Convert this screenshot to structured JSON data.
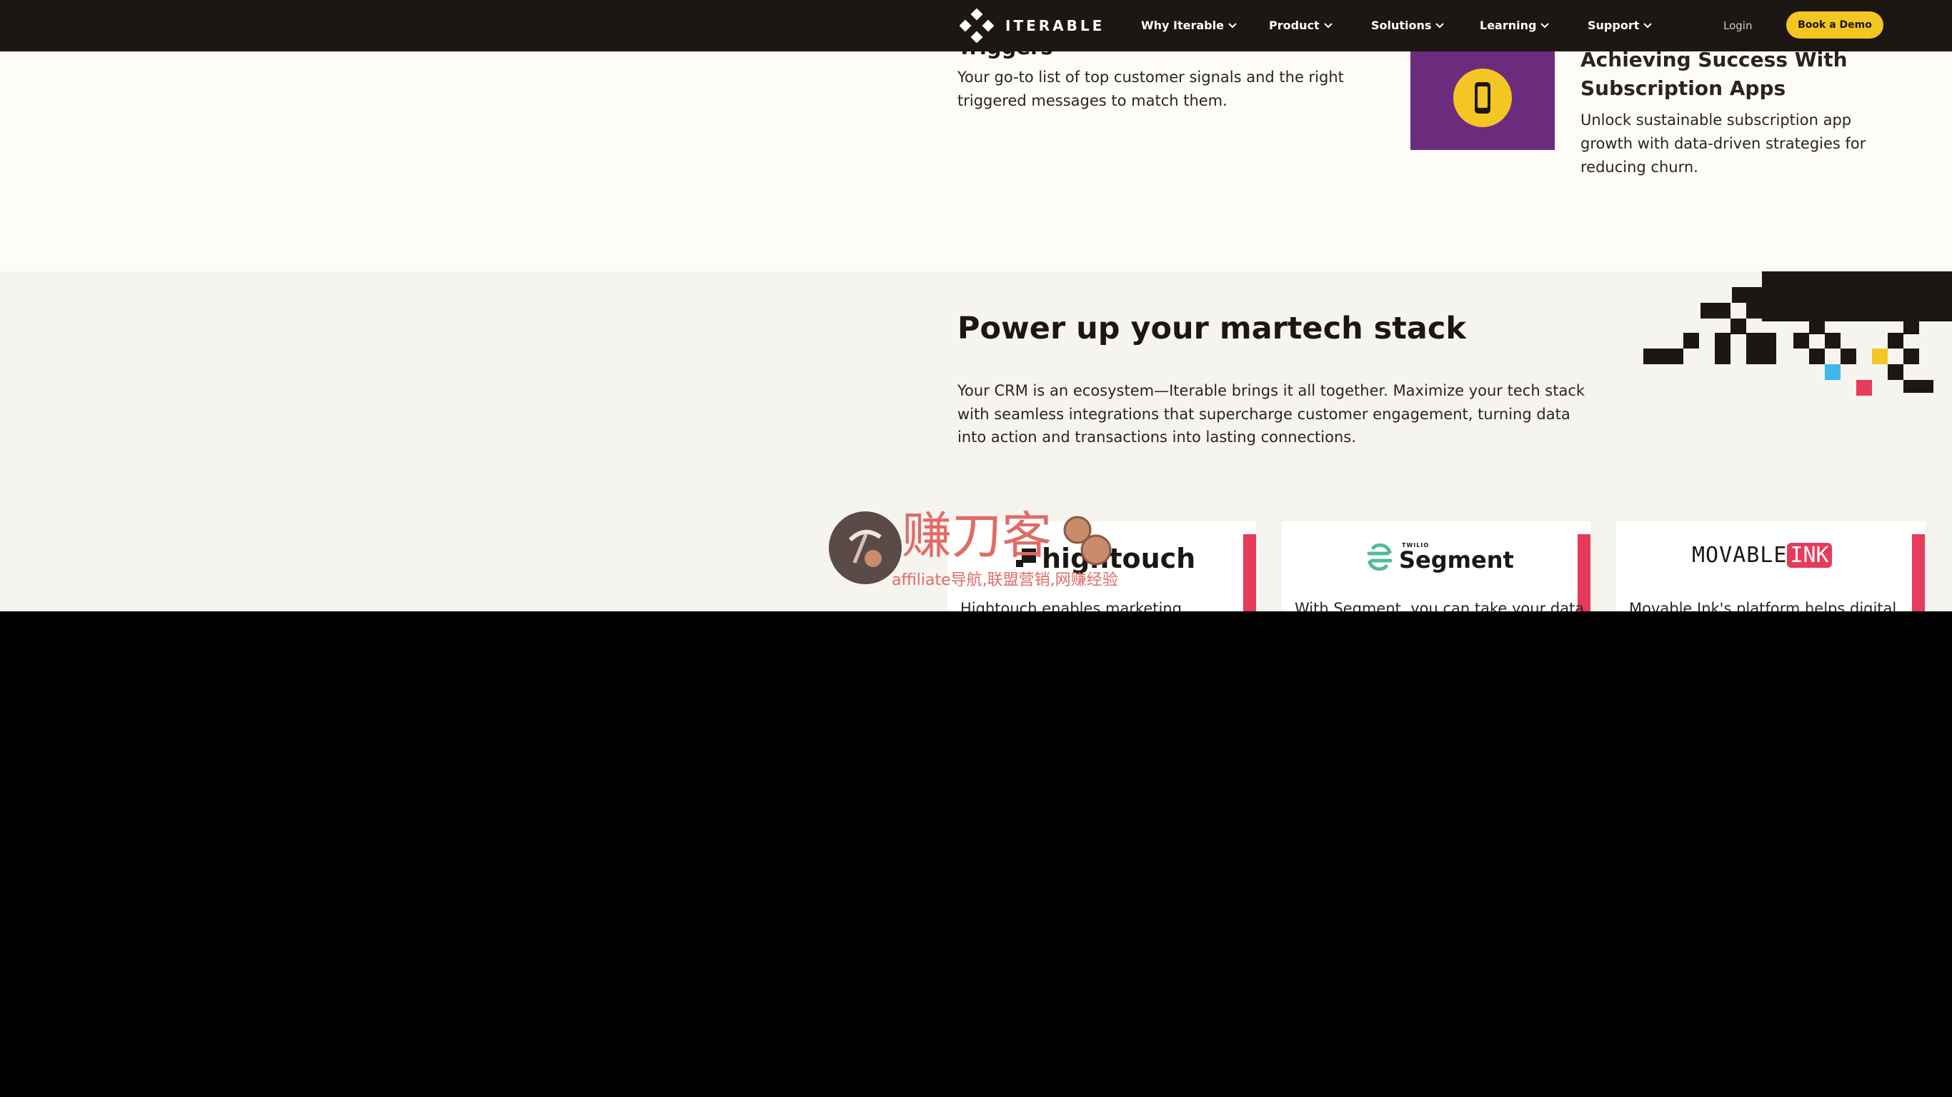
{
  "nav": {
    "brand": "ITERABLE",
    "items": [
      {
        "label": "Why Iterable"
      },
      {
        "label": "Product"
      },
      {
        "label": "Solutions"
      },
      {
        "label": "Learning"
      },
      {
        "label": "Support"
      }
    ],
    "login_label": "Login",
    "cta_label": "Book a Demo"
  },
  "top_cards": {
    "triggers": {
      "title": "Triggers",
      "description": "Your go-to list of top customer signals and the right triggered messages to match them."
    },
    "subscription": {
      "title": "Achieving Success With Subscription Apps",
      "description": "Unlock sustainable subscription app growth with data-driven strategies for reducing churn."
    }
  },
  "martech": {
    "title": "Power up your martech stack",
    "description": "Your CRM is an ecosystem—Iterable brings it all together. Maximize your tech stack with seamless integrations that supercharge customer engagement, turning data into action and transactions into lasting connections."
  },
  "integrations": [
    {
      "name": "hightouch",
      "description_peek": "Hightouch enables marketing"
    },
    {
      "name": "Segment",
      "brand_prefix": "TWILIO",
      "description_peek": "With Segment, you can take your data"
    },
    {
      "name": "MOVABLE",
      "name_highlight": "INK",
      "description_peek": "Movable Ink's platform helps digital"
    }
  ],
  "watermark": {
    "title": "赚刀客",
    "subtitle": "affiliate导航,联盟营销,网赚经验"
  },
  "colors": {
    "nav_bg": "#1c1712",
    "page_bg": "#fdfcf7",
    "section_bg": "#f6f4ef",
    "accent_yellow": "#f4c623",
    "accent_purple": "#6b2c7e",
    "accent_red": "#e63b5b",
    "segment_green": "#52bd94"
  }
}
